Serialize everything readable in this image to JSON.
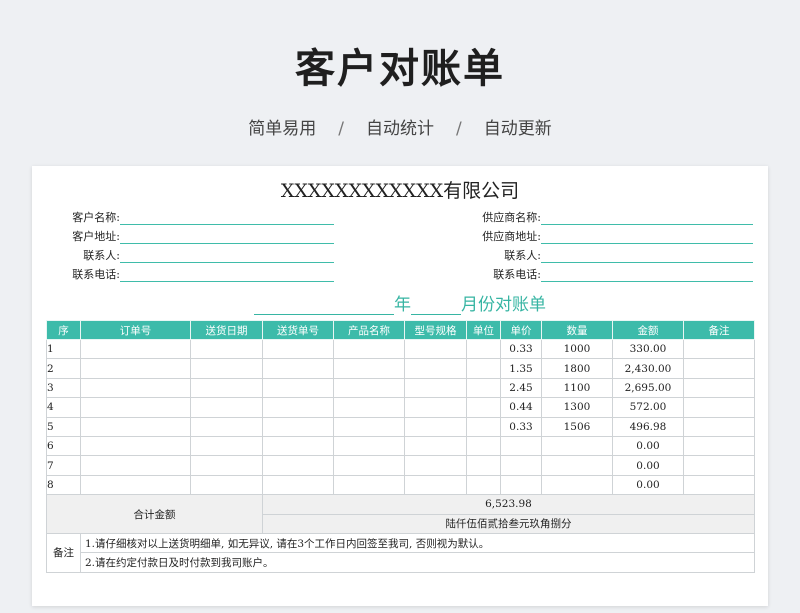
{
  "header": {
    "title": "客户对账单",
    "tags": [
      "简单易用",
      "自动统计",
      "自动更新"
    ],
    "separator": "/"
  },
  "sheet": {
    "company": "XXXXXXXXXXXX有限公司",
    "left_fields": [
      "客户名称:",
      "客户地址:",
      "联系人:",
      "联系电话:"
    ],
    "right_fields": [
      "供应商名称:",
      "供应商地址:",
      "联系人:",
      "联系电话:"
    ],
    "month_title": {
      "year_label": "年",
      "month_label": "月份对账单"
    },
    "columns": [
      "序",
      "订单号",
      "送货日期",
      "送货单号",
      "产品名称",
      "型号规格",
      "单位",
      "单价",
      "数量",
      "金额",
      "备注"
    ],
    "rows": [
      {
        "no": "1",
        "price": "0.33",
        "qty": "1000",
        "amount": "330.00"
      },
      {
        "no": "2",
        "price": "1.35",
        "qty": "1800",
        "amount": "2,430.00"
      },
      {
        "no": "3",
        "price": "2.45",
        "qty": "1100",
        "amount": "2,695.00"
      },
      {
        "no": "4",
        "price": "0.44",
        "qty": "1300",
        "amount": "572.00"
      },
      {
        "no": "5",
        "price": "0.33",
        "qty": "1506",
        "amount": "496.98"
      },
      {
        "no": "6",
        "price": "",
        "qty": "",
        "amount": "0.00"
      },
      {
        "no": "7",
        "price": "",
        "qty": "",
        "amount": "0.00"
      },
      {
        "no": "8",
        "price": "",
        "qty": "",
        "amount": "0.00"
      }
    ],
    "total": {
      "label": "合计金额",
      "number": "6,523.98",
      "chinese": "陆仟伍佰贰拾叁元玖角捌分"
    },
    "remarks": {
      "label": "备注",
      "lines": [
        "1.请仔细核对以上送货明细单, 如无异议, 请在3个工作日内回签至我司, 否则视为默认。",
        "2.请在约定付款日及时付款到我司账户。"
      ]
    }
  },
  "colors": {
    "accent": "#3dbbaa",
    "title": "#1f1f1f"
  }
}
